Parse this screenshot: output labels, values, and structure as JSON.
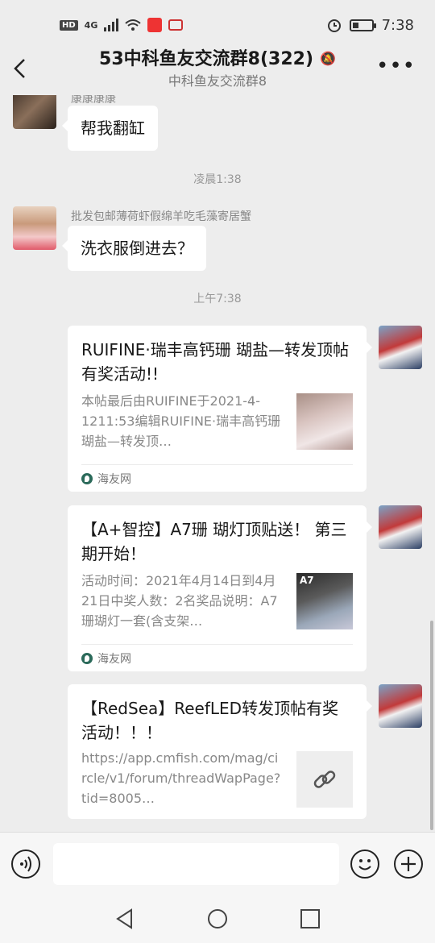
{
  "status_bar": {
    "network_badge": "HD",
    "network_type": "4G",
    "time": "7:38",
    "battery_percent": 30
  },
  "header": {
    "title": "53中科鱼友交流群8(322)",
    "subtitle": "中科鱼友交流群8"
  },
  "messages": {
    "m1": {
      "sender": "康康康康",
      "text": "帮我翻缸"
    },
    "ts1": "凌晨1:38",
    "m2": {
      "sender": "批发包邮薄荷虾假绵羊吃毛藻寄居蟹",
      "text": "洗衣服倒进去？"
    },
    "ts2": "上午7:38"
  },
  "cards": [
    {
      "title": "RUIFINE·瑞丰高钙珊 瑚盐—转发顶帖有奖活动!!",
      "desc": "本帖最后由RUIFINE于2021-4-1211:53编辑RUIFINE·瑞丰高钙珊瑚盐—转发顶…",
      "source": "海友网"
    },
    {
      "title": "【A+智控】A7珊 瑚灯顶贴送！ 第三期开始！",
      "desc": "活动时间：2021年4月14日到4月21日中奖人数：2名奖品说明：A7珊瑚灯一套(含支架…",
      "source": "海友网",
      "thumb_label": "A7"
    },
    {
      "title": "【RedSea】ReefLED转发顶帖有奖活动！！！",
      "desc": "https://app.cmfish.com/mag/circle/v1/forum/threadWapPage?tid=8005…"
    }
  ],
  "input": {
    "placeholder": ""
  },
  "colors": {
    "background": "#ededed",
    "bubble": "#ffffff",
    "timestamp": "#999999"
  }
}
